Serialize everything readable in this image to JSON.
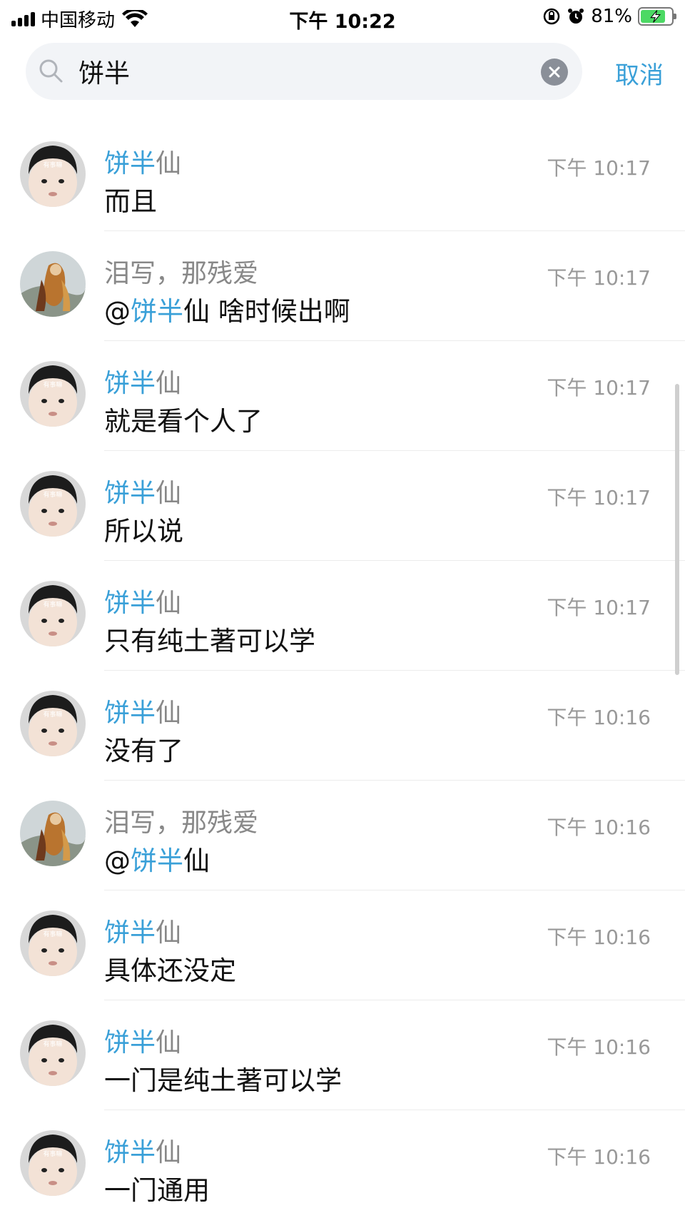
{
  "status_bar": {
    "carrier": "中国移动",
    "time": "下午 10:22",
    "battery_percent": "81%",
    "battery_level": 0.81,
    "icons": [
      "signal-icon",
      "wifi-icon",
      "orientation-lock-icon",
      "alarm-icon",
      "battery-charging-icon"
    ]
  },
  "search": {
    "value": "饼半",
    "cancel_label": "取消"
  },
  "colors": {
    "accent": "#3aa0d8",
    "muted": "#888888",
    "time": "#999999"
  },
  "messages": [
    {
      "sender_hl": "饼半",
      "sender_rest": "仙",
      "msg_pre": "",
      "msg_hl": "",
      "msg_post": "而且",
      "time": "下午 10:17",
      "avatar": "baby"
    },
    {
      "sender_hl": "",
      "sender_rest": "泪写，那残爱",
      "msg_pre": "@",
      "msg_hl": "饼半",
      "msg_post": "仙 啥时候出啊",
      "time": "下午 10:17",
      "avatar": "painting"
    },
    {
      "sender_hl": "饼半",
      "sender_rest": "仙",
      "msg_pre": "",
      "msg_hl": "",
      "msg_post": "就是看个人了",
      "time": "下午 10:17",
      "avatar": "baby"
    },
    {
      "sender_hl": "饼半",
      "sender_rest": "仙",
      "msg_pre": "",
      "msg_hl": "",
      "msg_post": "所以说",
      "time": "下午 10:17",
      "avatar": "baby"
    },
    {
      "sender_hl": "饼半",
      "sender_rest": "仙",
      "msg_pre": "",
      "msg_hl": "",
      "msg_post": "只有纯土著可以学",
      "time": "下午 10:17",
      "avatar": "baby"
    },
    {
      "sender_hl": "饼半",
      "sender_rest": "仙",
      "msg_pre": "",
      "msg_hl": "",
      "msg_post": "没有了",
      "time": "下午 10:16",
      "avatar": "baby"
    },
    {
      "sender_hl": "",
      "sender_rest": "泪写，那残爱",
      "msg_pre": "@",
      "msg_hl": "饼半",
      "msg_post": "仙",
      "time": "下午 10:16",
      "avatar": "painting"
    },
    {
      "sender_hl": "饼半",
      "sender_rest": "仙",
      "msg_pre": "",
      "msg_hl": "",
      "msg_post": "具体还没定",
      "time": "下午 10:16",
      "avatar": "baby"
    },
    {
      "sender_hl": "饼半",
      "sender_rest": "仙",
      "msg_pre": "",
      "msg_hl": "",
      "msg_post": "一门是纯土著可以学",
      "time": "下午 10:16",
      "avatar": "baby"
    },
    {
      "sender_hl": "饼半",
      "sender_rest": "仙",
      "msg_pre": "",
      "msg_hl": "",
      "msg_post": "一门通用",
      "time": "下午 10:16",
      "avatar": "baby"
    }
  ],
  "avatar_caption": "有事嘛"
}
